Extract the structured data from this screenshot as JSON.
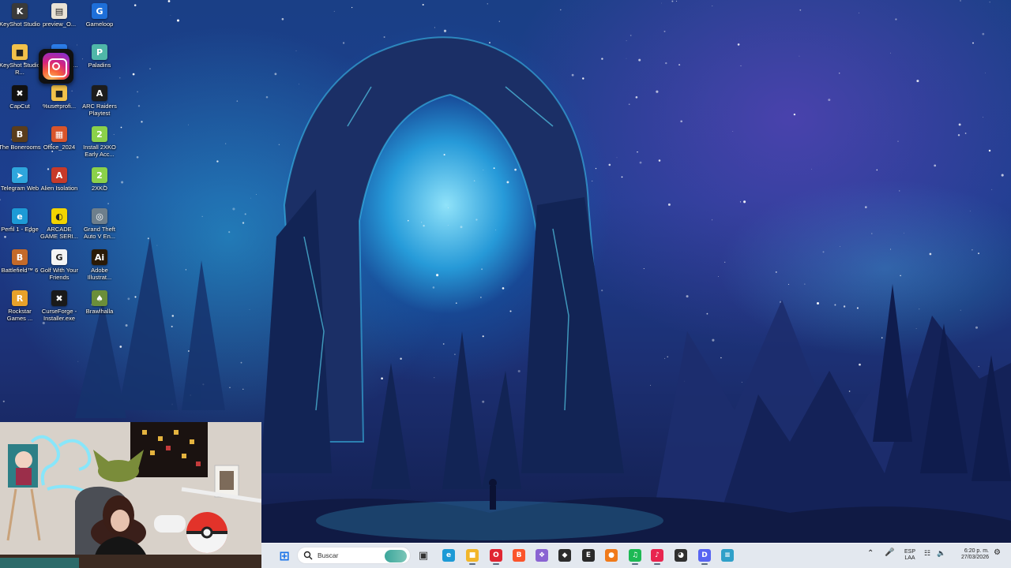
{
  "desktop": {
    "icons": [
      {
        "id": "keyshot-studio",
        "label": "KeyShot Studio",
        "glyph": "K",
        "color": "#3a3a3a"
      },
      {
        "id": "preview",
        "label": "preview_O...",
        "glyph": "▤",
        "color": "#e9e2d5"
      },
      {
        "id": "gameloop",
        "label": "Gameloop",
        "glyph": "G",
        "color": "#1e6fd9"
      },
      {
        "id": "keyshot-studio-r",
        "label": "KeyShot Studio R...",
        "glyph": "■",
        "color": "#f2c14a"
      },
      {
        "id": "onedrive",
        "label": "OneDriveSe...",
        "glyph": "☁",
        "color": "#2b7de9"
      },
      {
        "id": "paladins",
        "label": "Paladins",
        "glyph": "P",
        "color": "#4fb7a8"
      },
      {
        "id": "capcut",
        "label": "CapCut",
        "glyph": "✖",
        "color": "#111111"
      },
      {
        "id": "userprofile",
        "label": "%userprofi...",
        "glyph": "■",
        "color": "#f2c14a"
      },
      {
        "id": "arc-raiders",
        "label": "ARC Raiders Playtest",
        "glyph": "A",
        "color": "#1d1d1d"
      },
      {
        "id": "the-bonerooms",
        "label": "The Bonerooms",
        "glyph": "B",
        "color": "#5a3d1c"
      },
      {
        "id": "office-2024",
        "label": "Office_2024",
        "glyph": "▦",
        "color": "#d9552b"
      },
      {
        "id": "install-2xko",
        "label": "Install 2XKO Early Acc...",
        "glyph": "2",
        "color": "#8bd14a"
      },
      {
        "id": "telegram-web",
        "label": "Telegram Web",
        "glyph": "➤",
        "color": "#2ea6dd"
      },
      {
        "id": "alien-isolation",
        "label": "Alien Isolation",
        "glyph": "A",
        "color": "#c73a2a"
      },
      {
        "id": "2xko",
        "label": "2XKO",
        "glyph": "2",
        "color": "#8bd14a"
      },
      {
        "id": "perfil-edge",
        "label": "Perfil 1 - Edge",
        "glyph": "e",
        "color": "#1d9ad6"
      },
      {
        "id": "arcade-game-series",
        "label": "ARCADE GAME SERI...",
        "glyph": "◐",
        "color": "#f2d400"
      },
      {
        "id": "gta-v",
        "label": "Grand Theft Auto V En...",
        "glyph": "◎",
        "color": "#6e7f8c"
      },
      {
        "id": "battlefield-6",
        "label": "Battlefield™ 6",
        "glyph": "B",
        "color": "#c46a2a"
      },
      {
        "id": "golf-with-friends",
        "label": "Golf With Your Friends",
        "glyph": "G",
        "color": "#f4f4f4"
      },
      {
        "id": "adobe-illustrator",
        "label": "Adobe Illustrat...",
        "glyph": "Ai",
        "color": "#2a1a06"
      },
      {
        "id": "rockstar-games",
        "label": "Rockstar Games ...",
        "glyph": "R",
        "color": "#e7a12a"
      },
      {
        "id": "curseforge",
        "label": "CurseForge - Installer.exe",
        "glyph": "✖",
        "color": "#1a1a1a"
      },
      {
        "id": "brawlhalla",
        "label": "Brawlhalla",
        "glyph": "♠",
        "color": "#6b8e3a"
      }
    ]
  },
  "taskbar": {
    "search_placeholder": "Buscar",
    "apps": [
      {
        "id": "start",
        "glyph": "⊞",
        "color": "#1a73e8"
      },
      {
        "id": "task-view",
        "glyph": "▣",
        "color": "#333333"
      },
      {
        "id": "edge",
        "glyph": "e",
        "color": "#1d9ad6"
      },
      {
        "id": "file-explorer",
        "glyph": "■",
        "color": "#f2b62a"
      },
      {
        "id": "opera",
        "glyph": "O",
        "color": "#e02531"
      },
      {
        "id": "brave",
        "glyph": "B",
        "color": "#fb542b"
      },
      {
        "id": "copilot",
        "glyph": "❖",
        "color": "#8a63d2"
      },
      {
        "id": "app-cube",
        "glyph": "◆",
        "color": "#2c2c2c"
      },
      {
        "id": "epic-games",
        "glyph": "E",
        "color": "#2a2a2a"
      },
      {
        "id": "app-orange",
        "glyph": "●",
        "color": "#f07a1a"
      },
      {
        "id": "spotify",
        "glyph": "♫",
        "color": "#1db954"
      },
      {
        "id": "tiktok",
        "glyph": "♪",
        "color": "#e8254f"
      },
      {
        "id": "davinci",
        "glyph": "◕",
        "color": "#303030"
      },
      {
        "id": "discord",
        "glyph": "D",
        "color": "#5865f2"
      },
      {
        "id": "notepad",
        "glyph": "≡",
        "color": "#2fa0c9"
      }
    ],
    "tray": {
      "language_line1": "ESP",
      "language_line2": "LAA",
      "time": "6:20 p. m.",
      "date": "27/03/2026"
    }
  },
  "colors": {
    "taskbar_bg": "#eef1f6",
    "wallpaper_glow": "#9be7ff"
  }
}
